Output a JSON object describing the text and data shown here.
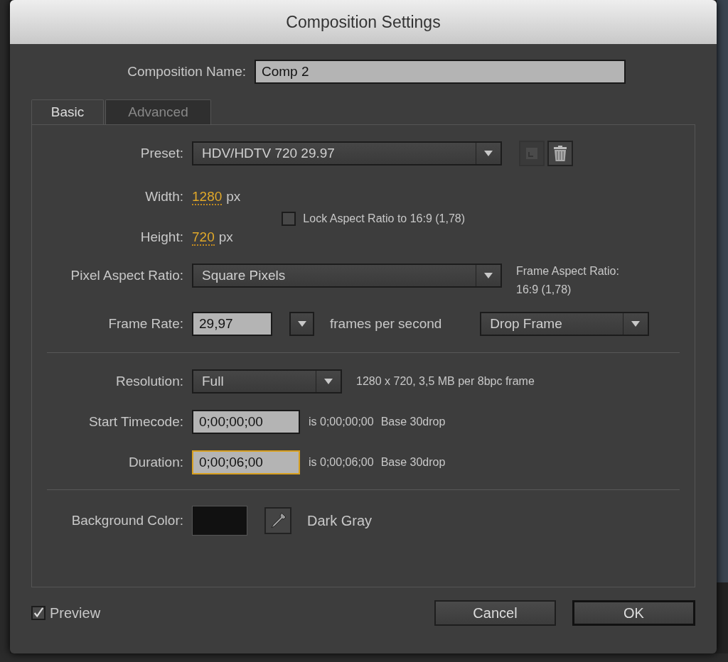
{
  "window": {
    "title": "Composition Settings"
  },
  "composition_name": {
    "label": "Composition Name:",
    "value": "Comp 2"
  },
  "tabs": [
    {
      "label": "Basic",
      "selected": true
    },
    {
      "label": "Advanced",
      "selected": false
    }
  ],
  "preset": {
    "label": "Preset:",
    "value": "HDV/HDTV 720 29.97"
  },
  "width": {
    "label": "Width:",
    "value": "1280",
    "unit": "px"
  },
  "height": {
    "label": "Height:",
    "value": "720",
    "unit": "px"
  },
  "lock_aspect": {
    "label": "Lock Aspect Ratio to 16:9 (1,78)",
    "checked": false
  },
  "pixel_aspect_ratio": {
    "label": "Pixel Aspect Ratio:",
    "value": "Square Pixels"
  },
  "frame_aspect_ratio": {
    "label": "Frame Aspect Ratio:",
    "value": "16:9 (1,78)"
  },
  "frame_rate": {
    "label": "Frame Rate:",
    "value": "29,97",
    "unit": "frames per second",
    "drop_frame": "Drop Frame"
  },
  "resolution": {
    "label": "Resolution:",
    "value": "Full",
    "info": "1280 x 720, 3,5 MB per 8bpc frame"
  },
  "start_timecode": {
    "label": "Start Timecode:",
    "value": "0;00;00;00",
    "is": "is 0;00;00;00",
    "base": "Base 30drop",
    "focused": false
  },
  "duration": {
    "label": "Duration:",
    "value": "0;00;06;00",
    "is": "is 0;00;06;00",
    "base": "Base 30drop",
    "focused": true
  },
  "background_color": {
    "label": "Background Color:",
    "color": "#111111",
    "name": "Dark Gray"
  },
  "preview": {
    "label": "Preview",
    "checked": true
  },
  "buttons": [
    {
      "label": "Cancel",
      "default": false
    },
    {
      "label": "OK",
      "default": true
    }
  ]
}
